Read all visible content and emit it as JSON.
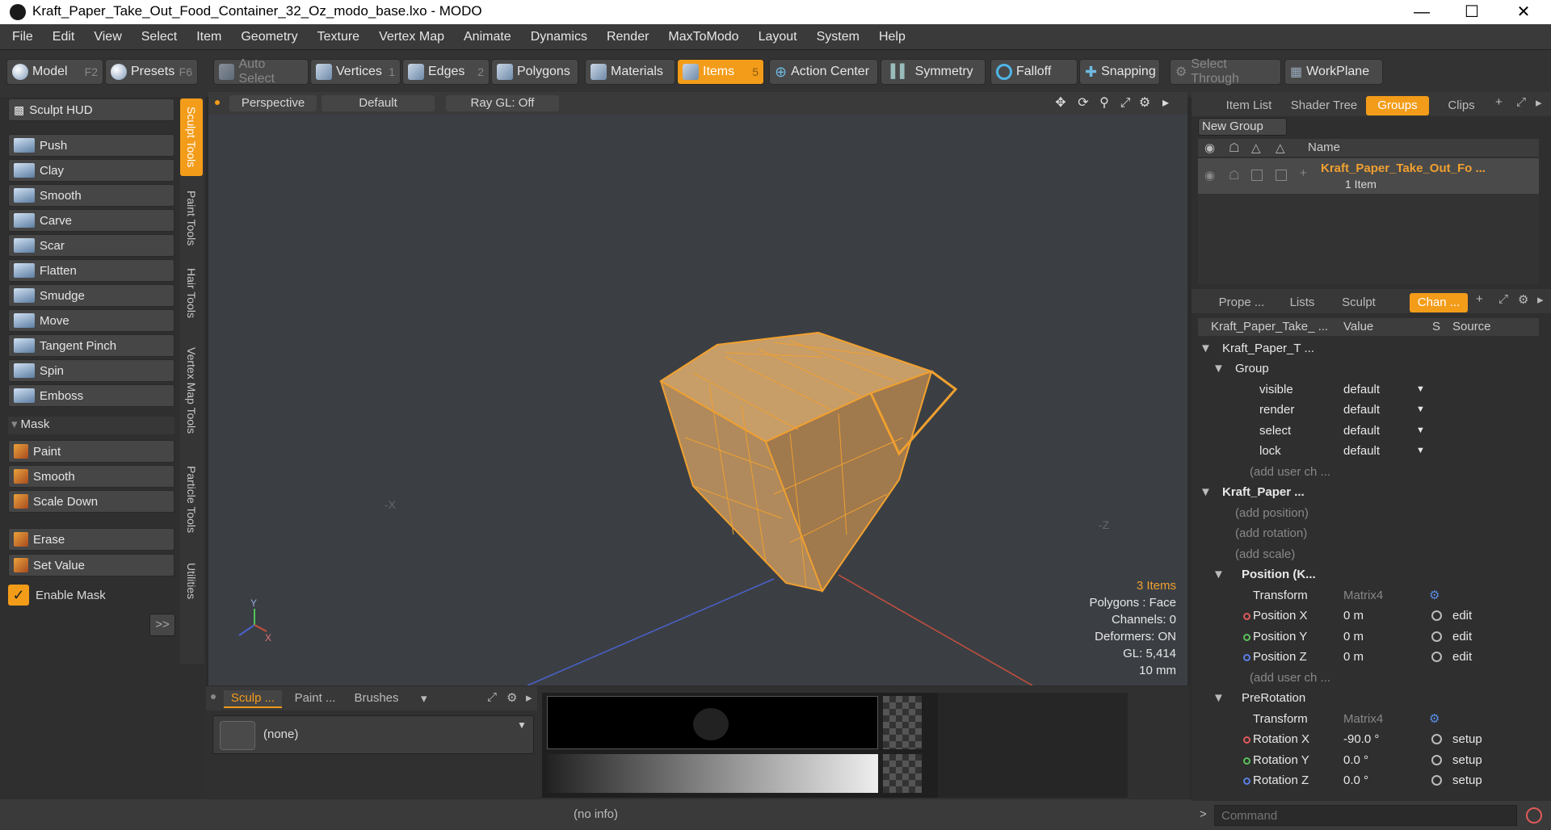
{
  "window": {
    "title": "Kraft_Paper_Take_Out_Food_Container_32_Oz_modo_base.lxo - MODO"
  },
  "menu": [
    "File",
    "Edit",
    "View",
    "Select",
    "Item",
    "Geometry",
    "Texture",
    "Vertex Map",
    "Animate",
    "Dynamics",
    "Render",
    "MaxToModo",
    "Layout",
    "System",
    "Help"
  ],
  "toolbar": {
    "model": "Model",
    "model_key": "F2",
    "presets": "Presets",
    "presets_key": "F6",
    "auto_select": "Auto Select",
    "vertices": "Vertices",
    "vertices_key": "1",
    "edges": "Edges",
    "edges_key": "2",
    "polygons": "Polygons",
    "materials": "Materials",
    "items": "Items",
    "items_key": "5",
    "action_center": "Action Center",
    "symmetry": "Symmetry",
    "falloff": "Falloff",
    "snapping": "Snapping",
    "select_through": "Select Through",
    "workplane": "WorkPlane"
  },
  "left": {
    "sculpt_hud": "Sculpt HUD",
    "tools": [
      "Push",
      "Clay",
      "Smooth",
      "Carve",
      "Scar",
      "Flatten",
      "Smudge",
      "Move",
      "Tangent Pinch",
      "Spin",
      "Emboss"
    ],
    "mask_header": "Mask",
    "mask_tools": [
      "Paint",
      "Smooth",
      "Scale Down"
    ],
    "erase": "Erase",
    "set_value": "Set Value",
    "enable_mask": "Enable Mask",
    "expand": ">>",
    "vtabs": [
      "Sculpt Tools",
      "Paint Tools",
      "Hair Tools",
      "Vertex Map Tools",
      "Particle Tools",
      "Utilities"
    ]
  },
  "viewport": {
    "view": "Perspective",
    "shading": "Default",
    "raygl": "Ray GL: Off",
    "stats": {
      "items": "3 Items",
      "polygons": "Polygons : Face",
      "channels": "Channels: 0",
      "deformers": "Deformers: ON",
      "gl": "GL: 5,414",
      "scale": "10 mm"
    },
    "axis_labels": {
      "neg_x": "-X",
      "neg_z": "-Z",
      "y": "Y",
      "x": "X"
    }
  },
  "bottom": {
    "tabs": [
      "Sculp ...",
      "Paint ...",
      "Brushes"
    ],
    "brush": "(none)"
  },
  "status": {
    "info": "(no info)"
  },
  "right": {
    "top_tabs": [
      "Item List",
      "Shader Tree",
      "Groups",
      "Clips"
    ],
    "new_group": "New Group",
    "col_name": "Name",
    "group_name": "Kraft_Paper_Take_Out_Fo ...",
    "group_count": "1 Item",
    "tabs2": [
      "Prope ...",
      "Lists",
      "Sculpt",
      "Chan ..."
    ],
    "ch_headers": {
      "name": "Kraft_Paper_Take_ ...",
      "value": "Value",
      "s": "S",
      "source": "Source"
    },
    "rows": [
      {
        "label": "Kraft_Paper_T ...",
        "value": "",
        "source": ""
      },
      {
        "label": "Group",
        "value": "",
        "source": ""
      },
      {
        "label": "visible",
        "value": "default",
        "source": ""
      },
      {
        "label": "render",
        "value": "default",
        "source": ""
      },
      {
        "label": "select",
        "value": "default",
        "source": ""
      },
      {
        "label": "lock",
        "value": "default",
        "source": ""
      },
      {
        "label": "(add user ch ...",
        "value": "",
        "source": ""
      },
      {
        "label": "Kraft_Paper ...",
        "value": "",
        "source": ""
      },
      {
        "label": "(add position)",
        "value": "",
        "source": ""
      },
      {
        "label": "(add rotation)",
        "value": "",
        "source": ""
      },
      {
        "label": "(add scale)",
        "value": "",
        "source": ""
      },
      {
        "label": "Position (K...",
        "value": "",
        "source": ""
      },
      {
        "label": "Transform",
        "value": "Matrix4",
        "source": ""
      },
      {
        "label": "Position X",
        "value": "0 m",
        "source": "edit"
      },
      {
        "label": "Position Y",
        "value": "0 m",
        "source": "edit"
      },
      {
        "label": "Position Z",
        "value": "0 m",
        "source": "edit"
      },
      {
        "label": "(add user ch ...",
        "value": "",
        "source": ""
      },
      {
        "label": "PreRotation",
        "value": "",
        "source": ""
      },
      {
        "label": "Transform",
        "value": "Matrix4",
        "source": ""
      },
      {
        "label": "Rotation X",
        "value": "-90.0 °",
        "source": "setup"
      },
      {
        "label": "Rotation Y",
        "value": "0.0 °",
        "source": "setup"
      },
      {
        "label": "Rotation Z",
        "value": "0.0 °",
        "source": "setup"
      }
    ],
    "command_placeholder": "Command"
  },
  "colors": {
    "accent": "#f39c19",
    "wire": "#f0a030"
  }
}
